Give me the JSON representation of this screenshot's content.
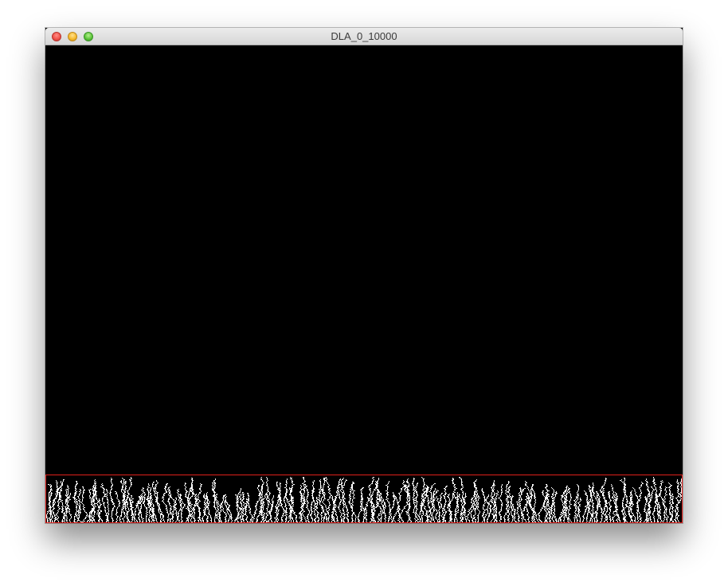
{
  "window": {
    "title": "DLA_0_10000"
  },
  "title_bar_buttons": [
    {
      "name": "close",
      "color": "#f2544c"
    },
    {
      "name": "minimize",
      "color": "#f6bb30"
    },
    {
      "name": "zoom",
      "color": "#5fc63c"
    }
  ],
  "canvas": {
    "background": "#000000",
    "particle_color": "#ffffff",
    "boundary_color": "#e0201c"
  }
}
